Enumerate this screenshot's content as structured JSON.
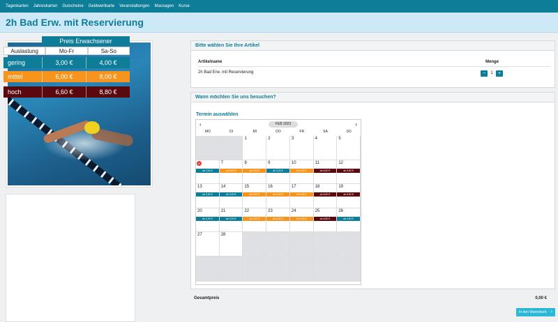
{
  "nav": [
    "Tageskarten",
    "Jahreskarten",
    "Gutscheine",
    "Geldwertkarte",
    "Veranstaltungen",
    "Massagen",
    "Kurse"
  ],
  "page_title": "2h Bad Erw. mit Reservierung",
  "prices": {
    "header": "Preis Erwachsener",
    "col_load": "Auslastung",
    "col_weekday": "Mo-Fr",
    "col_weekend": "Sa-So",
    "rows": [
      {
        "label": "gering",
        "weekday": "3,00 €",
        "weekend": "4,00 €"
      },
      {
        "label": "mittel",
        "weekday": "6,00 €",
        "weekend": "8,00 €"
      },
      {
        "label": "hoch",
        "weekday": "6,60 €",
        "weekend": "8,80 €"
      }
    ]
  },
  "articles": {
    "title": "Bitte wählen Sie Ihre Artikel",
    "col_name": "Artikelname",
    "col_qty": "Menge",
    "item_name": "2h Bad Erw. mit Reservierung",
    "qty": "1",
    "minus": "−",
    "plus": "+"
  },
  "visit": {
    "title": "Wann möchten Sie uns besuchen?",
    "subtitle": "Termin auswählen",
    "month": "FEB 2023",
    "prev": "‹",
    "next": "›",
    "weekdays": [
      "MO",
      "DI",
      "MI",
      "DO",
      "FR",
      "SA",
      "SO"
    ],
    "badge": "6"
  },
  "total": {
    "label": "Gesamtpreis",
    "value": "0,00 €"
  },
  "cart_button": "In den Warenkorb",
  "colors": {
    "low": "#0e7d98",
    "mid": "#f7941d",
    "high": "#5a0a0f"
  }
}
